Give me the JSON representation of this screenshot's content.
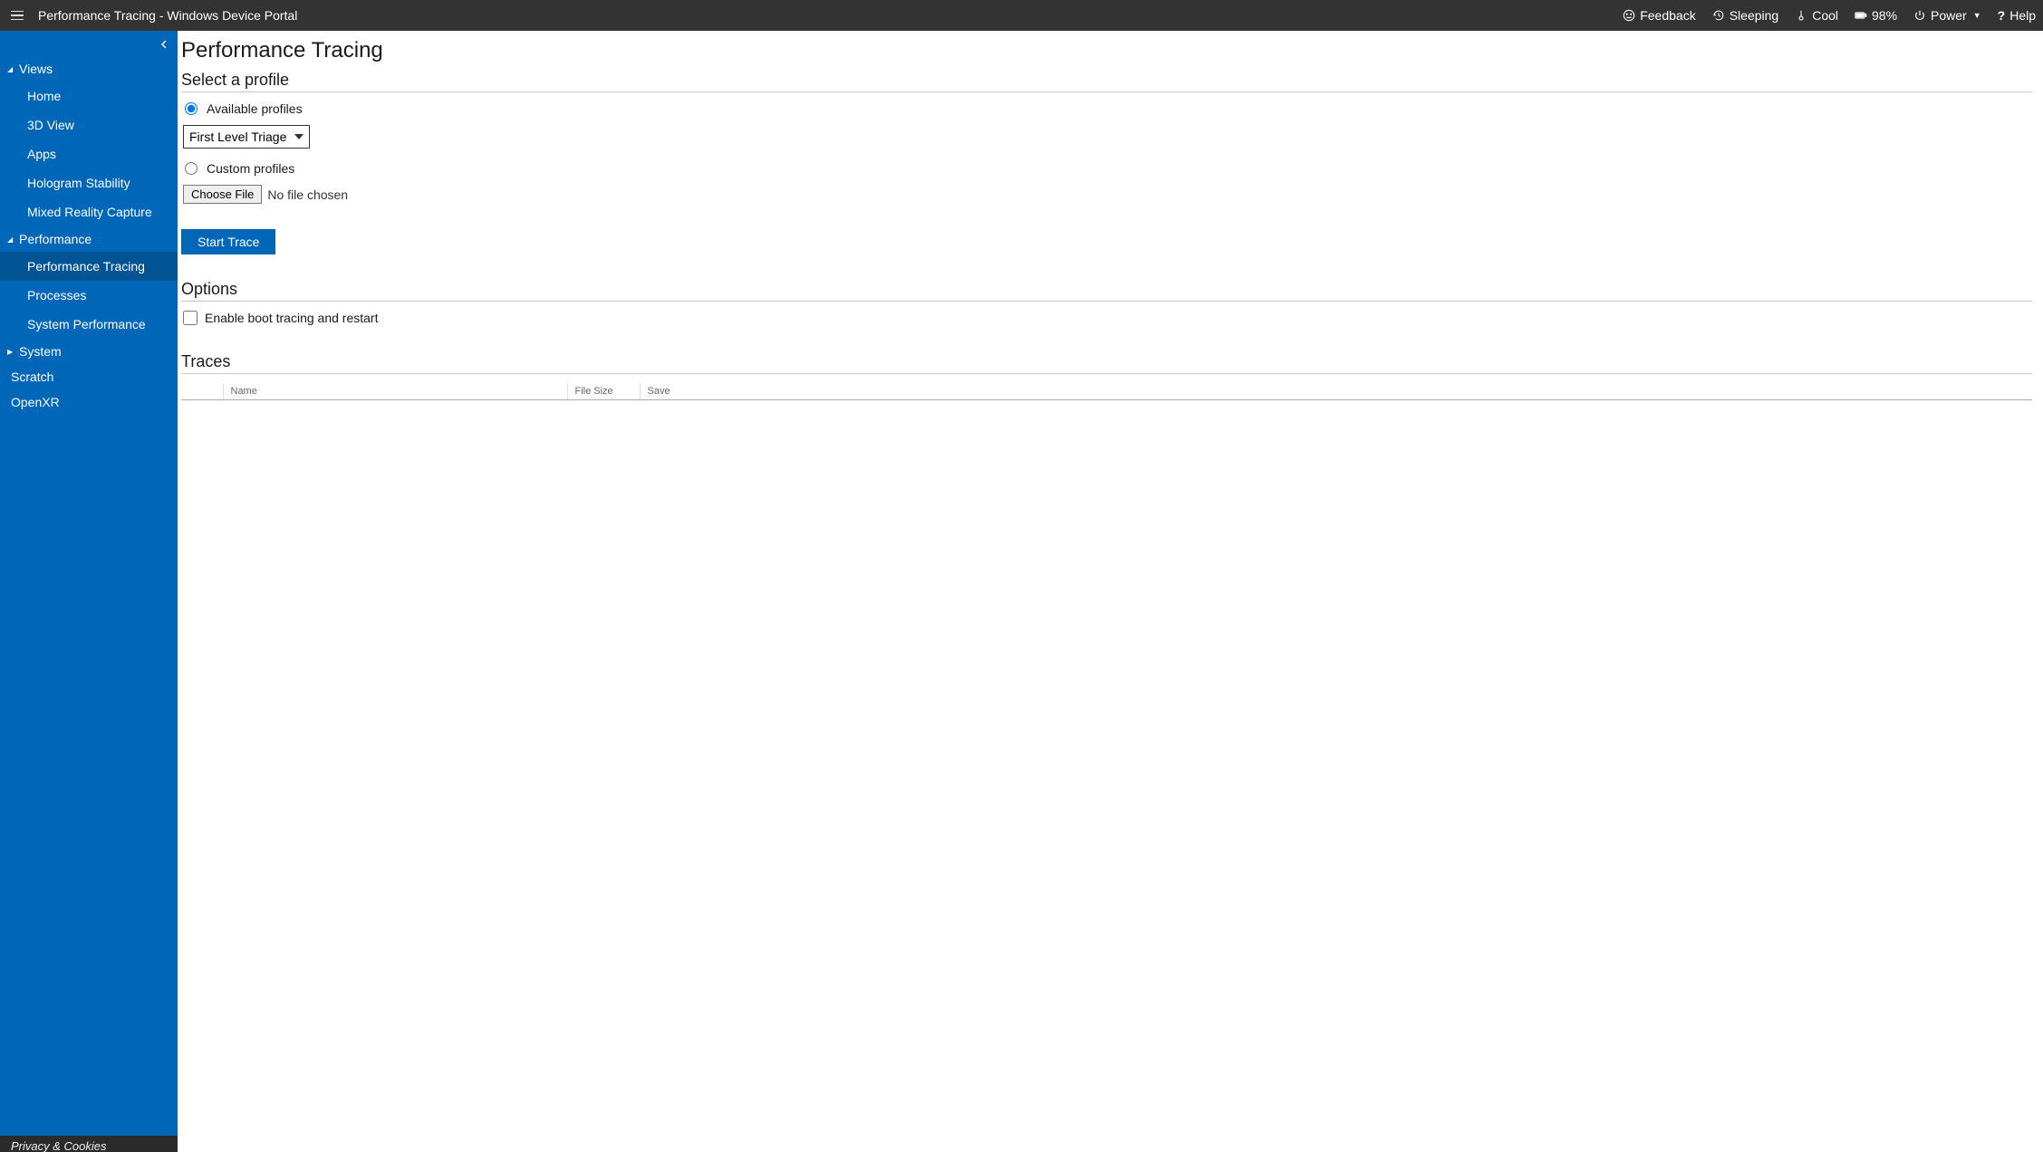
{
  "topbar": {
    "title": "Performance Tracing - Windows Device Portal",
    "items": {
      "feedback": "Feedback",
      "sleeping": "Sleeping",
      "cool": "Cool",
      "battery": "98%",
      "power": "Power",
      "help": "Help"
    }
  },
  "sidebar": {
    "groups": [
      {
        "label": "Views",
        "expanded": true,
        "items": [
          "Home",
          "3D View",
          "Apps",
          "Hologram Stability",
          "Mixed Reality Capture"
        ]
      },
      {
        "label": "Performance",
        "expanded": true,
        "items": [
          "Performance Tracing",
          "Processes",
          "System Performance"
        ],
        "active": "Performance Tracing"
      },
      {
        "label": "System",
        "expanded": false,
        "items": []
      }
    ],
    "loose": [
      "Scratch",
      "OpenXR"
    ],
    "footer": "Privacy & Cookies"
  },
  "page": {
    "title": "Performance Tracing",
    "section_profile": "Select a profile",
    "radio_available": "Available profiles",
    "profile_selected": "First Level Triage",
    "radio_custom": "Custom profiles",
    "choose_file_btn": "Choose File",
    "no_file": "No file chosen",
    "start_trace": "Start Trace",
    "section_options": "Options",
    "boot_tracing": "Enable boot tracing and restart",
    "section_traces": "Traces",
    "table_headers": {
      "blank": "",
      "name": "Name",
      "file_size": "File Size",
      "save": "Save"
    }
  }
}
